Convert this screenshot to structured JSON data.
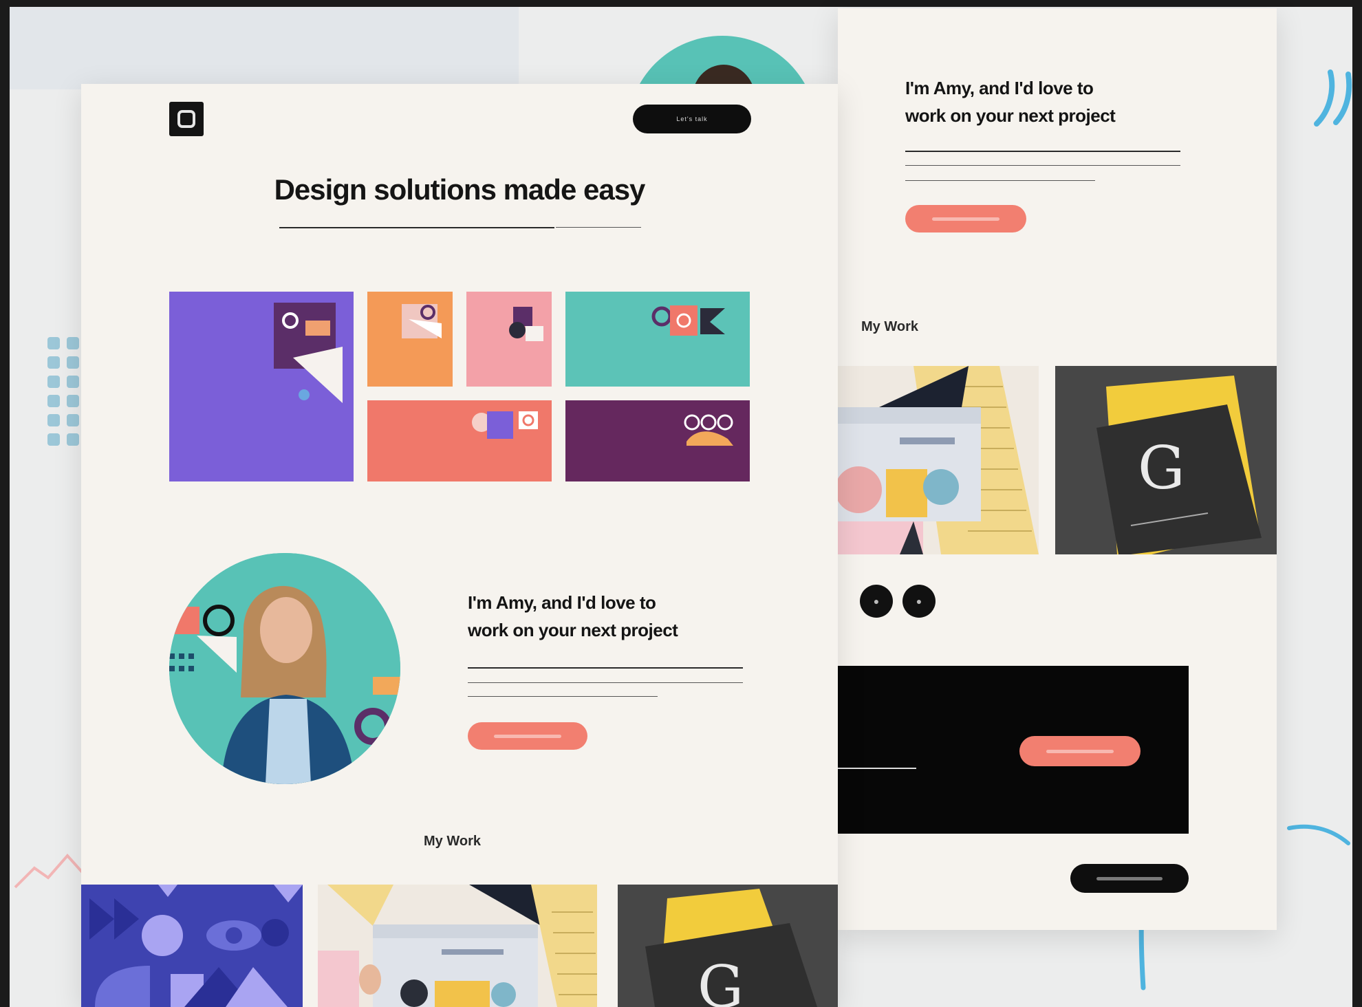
{
  "main": {
    "logo_icon": "ring-icon",
    "nav_button_label": "Let's talk",
    "hero_title": "Design solutions made easy",
    "hero_subtitle": "",
    "tiles": [
      {
        "label": "",
        "color": "#7b5fd8"
      },
      {
        "label": "",
        "color": "#f49a57"
      },
      {
        "label": "",
        "color": "#f3a1a8"
      },
      {
        "label": "",
        "color": "#5cc3b7"
      },
      {
        "label": "",
        "color": "#f0786a"
      },
      {
        "label": "",
        "color": "#65285e"
      }
    ],
    "pitch_line1": "I'm Amy, and I'd love to",
    "pitch_line2": "work on your next project",
    "cta_label": "",
    "work_heading": "My Work"
  },
  "right": {
    "pitch_line1": "I'm Amy, and I'd love to",
    "pitch_line2": "work on your next project",
    "cta_label": "",
    "work_heading": "My Work",
    "prev_icon": "chevron-left-icon",
    "next_icon": "chevron-right-icon",
    "contact_text": "",
    "contact_button_label": "",
    "footer_button_label": ""
  },
  "colors": {
    "coral": "#f27f70",
    "teal": "#58c2b6",
    "purple": "#7b5fd8",
    "plum": "#65285e",
    "dark": "#0e0e0e"
  }
}
